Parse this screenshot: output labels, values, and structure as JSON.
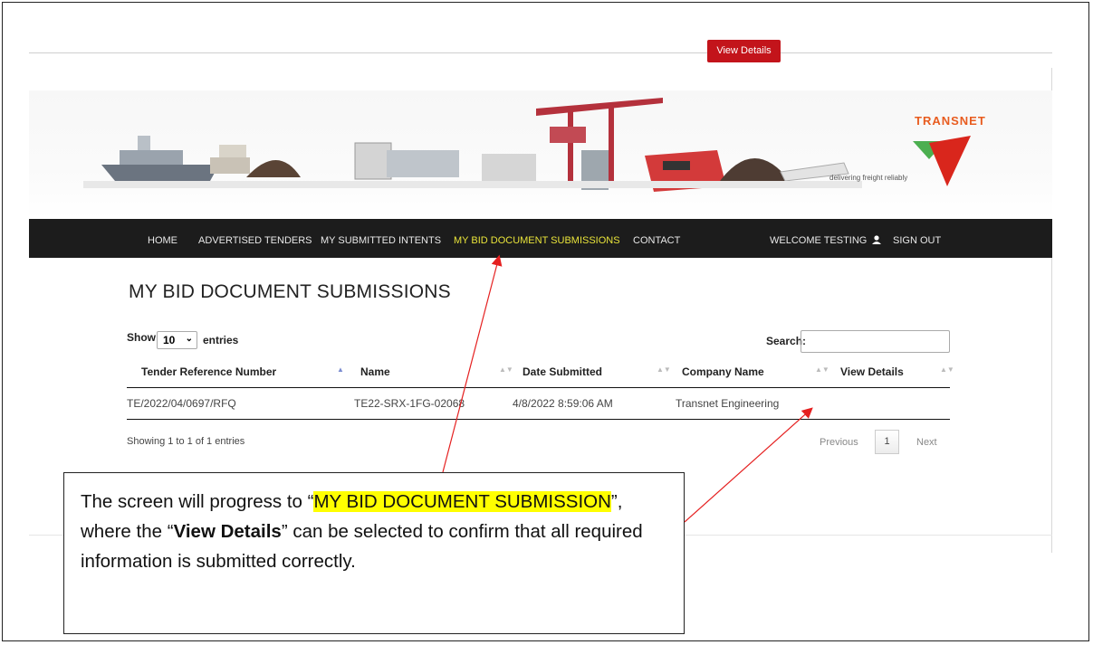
{
  "banner": {
    "brand": "TRANSNET",
    "tagline": "delivering freight reliably"
  },
  "nav": {
    "home": "HOME",
    "advertised": "ADVERTISED TENDERS",
    "intents": "MY SUBMITTED INTENTS",
    "submissions": "MY BID DOCUMENT SUBMISSIONS",
    "contact": "CONTACT",
    "welcome": "WELCOME TESTING",
    "signout": "SIGN OUT",
    "active_color": "#e9e43a"
  },
  "page": {
    "title": "MY BID DOCUMENT SUBMISSIONS"
  },
  "controls": {
    "show": "Show",
    "entries_value": "10",
    "entries": "entries",
    "search_label": "Search:",
    "search_value": ""
  },
  "table": {
    "headers": [
      "Tender Reference Number",
      "Name",
      "Date Submitted",
      "Company Name",
      "View Details"
    ],
    "rows": [
      {
        "ref": "TE/2022/04/0697/RFQ",
        "name": "TE22-SRX-1FG-02068",
        "date": "4/8/2022 8:59:06 AM",
        "company": "Transnet Engineering",
        "action": "View Details"
      }
    ]
  },
  "footer": {
    "info": "Showing 1 to 1 of 1 entries",
    "previous": "Previous",
    "page": "1",
    "next": "Next"
  },
  "callout": {
    "t1": "The screen will progress to “",
    "t2": "MY BID DOCUMENT SUBMISSION",
    "t3": "”, where the “",
    "t4": "View Details",
    "t5": "” can be selected to confirm that all required information is submitted correctly."
  },
  "colors": {
    "button": "#c3141b",
    "brand_orange": "#e85c1f",
    "brand_green": "#4caf50",
    "brand_red": "#d9261c",
    "arrow": "#e52020",
    "highlight": "#ffff00"
  }
}
